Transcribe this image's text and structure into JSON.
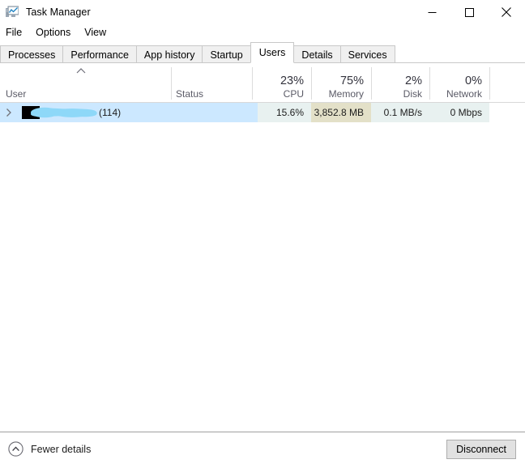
{
  "window": {
    "title": "Task Manager",
    "icon": "task-manager-icon",
    "controls": [
      {
        "name": "minimize-button",
        "glyph": "minimize-icon"
      },
      {
        "name": "maximize-button",
        "glyph": "maximize-icon"
      },
      {
        "name": "close-button",
        "glyph": "close-icon"
      }
    ]
  },
  "menubar": {
    "items": [
      {
        "label": "File"
      },
      {
        "label": "Options"
      },
      {
        "label": "View"
      }
    ]
  },
  "tabs": {
    "items": [
      {
        "label": "Processes",
        "active": false
      },
      {
        "label": "Performance",
        "active": false
      },
      {
        "label": "App history",
        "active": false
      },
      {
        "label": "Startup",
        "active": false
      },
      {
        "label": "Users",
        "active": true
      },
      {
        "label": "Details",
        "active": false
      },
      {
        "label": "Services",
        "active": false
      }
    ],
    "selected": "Users"
  },
  "table": {
    "sort_indicator": "sort-ascending-icon",
    "sort_column": "User",
    "columns": [
      {
        "name": "user",
        "header": "User",
        "percent": "",
        "align": "left"
      },
      {
        "name": "status",
        "header": "Status",
        "percent": "",
        "align": "left"
      },
      {
        "name": "cpu",
        "header": "CPU",
        "percent": "23%",
        "align": "right"
      },
      {
        "name": "memory",
        "header": "Memory",
        "percent": "75%",
        "align": "right"
      },
      {
        "name": "disk",
        "header": "Disk",
        "percent": "2%",
        "align": "right"
      },
      {
        "name": "network",
        "header": "Network",
        "percent": "0%",
        "align": "right"
      }
    ],
    "rows": [
      {
        "expanded": false,
        "expand_icon": "chevron-right-icon",
        "user_redacted": true,
        "user_name": "",
        "process_count": "(114)",
        "status": "",
        "cpu": "15.6%",
        "memory": "3,852.8 MB",
        "disk": "0.1 MB/s",
        "network": "0 Mbps",
        "selected": true
      }
    ]
  },
  "footer": {
    "fewer_details_label": "Fewer details",
    "fewer_details_icon": "chevron-up-circle-icon",
    "disconnect_label": "Disconnect"
  },
  "colors": {
    "selection_blue": "#cce8ff",
    "heat_low": "#e8f1f0",
    "heat_memory": "#e3e0c8",
    "redaction_black": "#000000",
    "highlighter_blue": "#8ed8f8",
    "accent_border": "#c8c8c8"
  }
}
